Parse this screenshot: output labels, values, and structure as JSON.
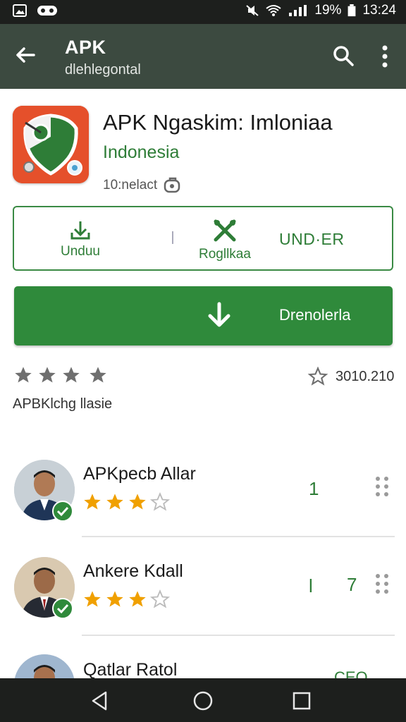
{
  "status_bar": {
    "battery": "19%",
    "time": "13:24",
    "icons": [
      "image-icon",
      "voicemail-icon",
      "mute-icon",
      "wifi-icon",
      "signal-icon",
      "battery-icon"
    ]
  },
  "app_bar": {
    "title": "APK",
    "subtitle": "dlehlegontal"
  },
  "app": {
    "title": "APK Ngaskim: Imloniaa",
    "developer": "Indonesia",
    "meta": "10:nelact",
    "icon_colors": {
      "background": "#e5502b",
      "shield": "#2e7d37"
    }
  },
  "actions": {
    "unduh_label": "Unduu",
    "aplikasi_label": "Rogllkaa",
    "under_label": "UND·ER"
  },
  "install": {
    "label": "Drenolerla"
  },
  "rating": {
    "stars": 4,
    "subtitle": "APBKlchg llasie",
    "count": "3010.210"
  },
  "reviews": [
    {
      "name": "APKpecb Allar",
      "stars": 3,
      "count": "1"
    },
    {
      "name": "Ankere Kdall",
      "stars": 3,
      "count": "7",
      "marker": "l"
    },
    {
      "name": "Qatlar Ratol",
      "stars": 0,
      "count": "CEO"
    }
  ],
  "colors": {
    "accent": "#2f8a3b",
    "appbar": "#3c4a40",
    "star": "#f0a000"
  }
}
